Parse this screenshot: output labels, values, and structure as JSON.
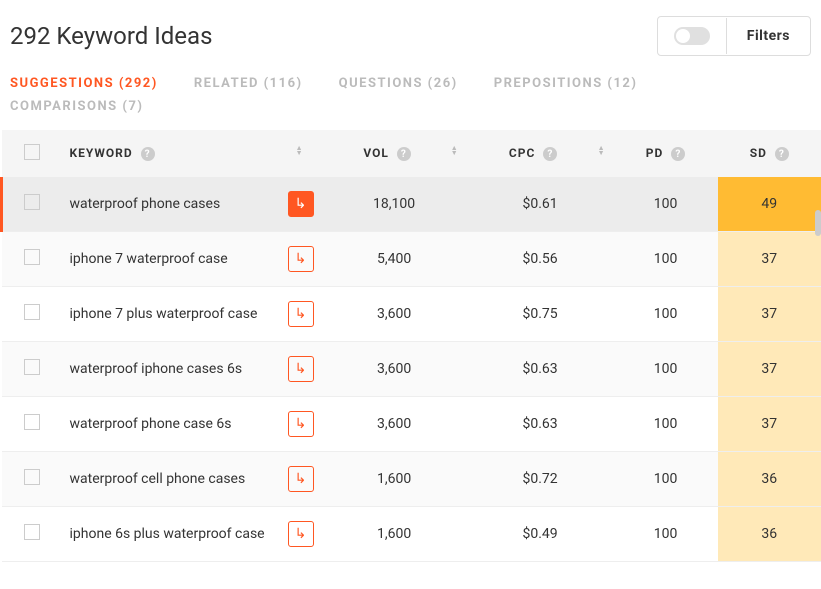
{
  "header": {
    "title": "292 Keyword Ideas",
    "filters_label": "Filters"
  },
  "tabs": [
    {
      "label": "SUGGESTIONS (292)",
      "active": true
    },
    {
      "label": "RELATED (116)",
      "active": false
    },
    {
      "label": "QUESTIONS (26)",
      "active": false
    },
    {
      "label": "PREPOSITIONS (12)",
      "active": false
    },
    {
      "label": "COMPARISONS (7)",
      "active": false
    }
  ],
  "columns": {
    "keyword": "KEYWORD",
    "vol": "VOL",
    "cpc": "CPC",
    "pd": "PD",
    "sd": "SD"
  },
  "rows": [
    {
      "keyword": "waterproof phone cases",
      "vol": "18,100",
      "cpc": "$0.61",
      "pd": "100",
      "sd": "49",
      "highlight": true,
      "filled": true
    },
    {
      "keyword": "iphone 7 waterproof case",
      "vol": "5,400",
      "cpc": "$0.56",
      "pd": "100",
      "sd": "37",
      "highlight": false,
      "filled": false
    },
    {
      "keyword": "iphone 7 plus waterproof case",
      "vol": "3,600",
      "cpc": "$0.75",
      "pd": "100",
      "sd": "37",
      "highlight": false,
      "filled": false
    },
    {
      "keyword": "waterproof iphone cases 6s",
      "vol": "3,600",
      "cpc": "$0.63",
      "pd": "100",
      "sd": "37",
      "highlight": false,
      "filled": false
    },
    {
      "keyword": "waterproof phone case 6s",
      "vol": "3,600",
      "cpc": "$0.63",
      "pd": "100",
      "sd": "37",
      "highlight": false,
      "filled": false
    },
    {
      "keyword": "waterproof cell phone cases",
      "vol": "1,600",
      "cpc": "$0.72",
      "pd": "100",
      "sd": "36",
      "highlight": false,
      "filled": false
    },
    {
      "keyword": "iphone 6s plus waterproof case",
      "vol": "1,600",
      "cpc": "$0.49",
      "pd": "100",
      "sd": "36",
      "highlight": false,
      "filled": false
    }
  ]
}
